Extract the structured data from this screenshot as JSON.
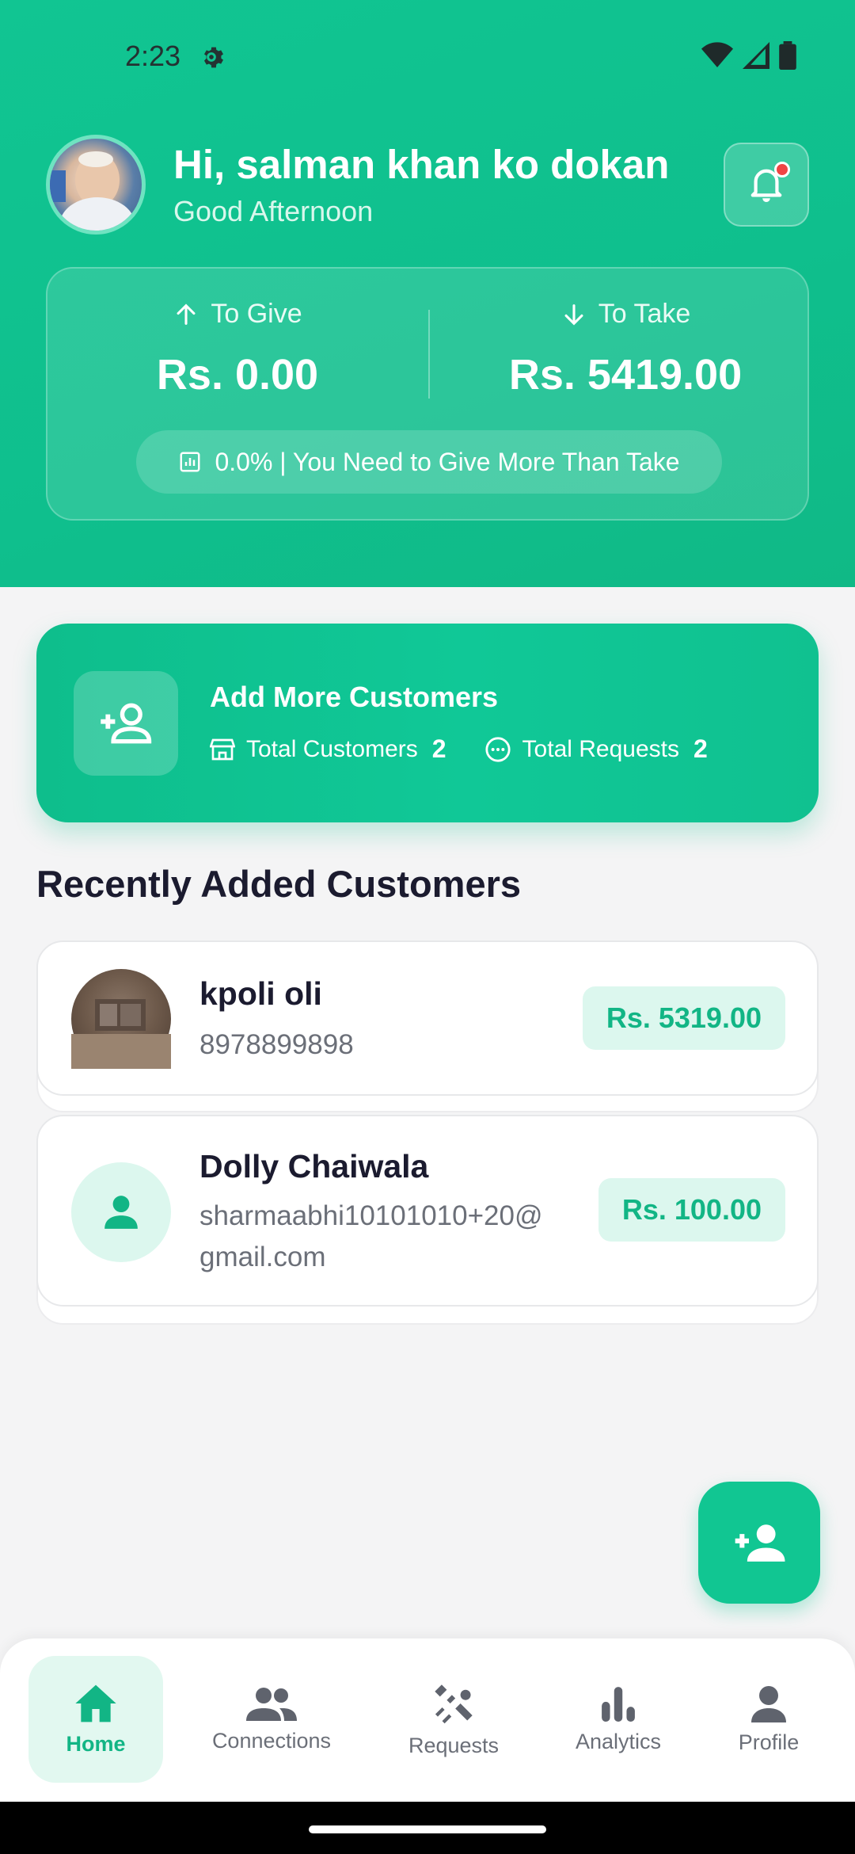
{
  "status_bar": {
    "time": "2:23"
  },
  "header": {
    "greeting": "Hi, salman khan ko dokan",
    "subgreeting": "Good Afternoon"
  },
  "balance": {
    "give_label": "To Give",
    "give_amount": "Rs. 0.00",
    "take_label": "To Take",
    "take_amount": "Rs. 5419.00",
    "summary": "0.0% | You Need to Give More Than Take"
  },
  "add_card": {
    "title": "Add More Customers",
    "total_customers_label": "Total Customers",
    "total_customers_value": "2",
    "total_requests_label": "Total Requests",
    "total_requests_value": "2"
  },
  "recent": {
    "title": "Recently Added Customers",
    "customers": [
      {
        "name": "kpoli oli",
        "contact": "8978899898",
        "amount": "Rs. 5319.00"
      },
      {
        "name": "Dolly Chaiwala",
        "contact_line1": "sharmaabhi10101010+20@",
        "contact_line2": "gmail.com",
        "amount": "Rs. 100.00"
      }
    ]
  },
  "nav": {
    "items": [
      {
        "label": "Home",
        "icon": "home-icon"
      },
      {
        "label": "Connections",
        "icon": "people-icon"
      },
      {
        "label": "Requests",
        "icon": "requests-icon"
      },
      {
        "label": "Analytics",
        "icon": "bar-chart-icon"
      },
      {
        "label": "Profile",
        "icon": "person-icon"
      }
    ]
  },
  "colors": {
    "accent": "#11c592",
    "accent_light": "#dcf7ee",
    "alert": "#ef4444"
  }
}
